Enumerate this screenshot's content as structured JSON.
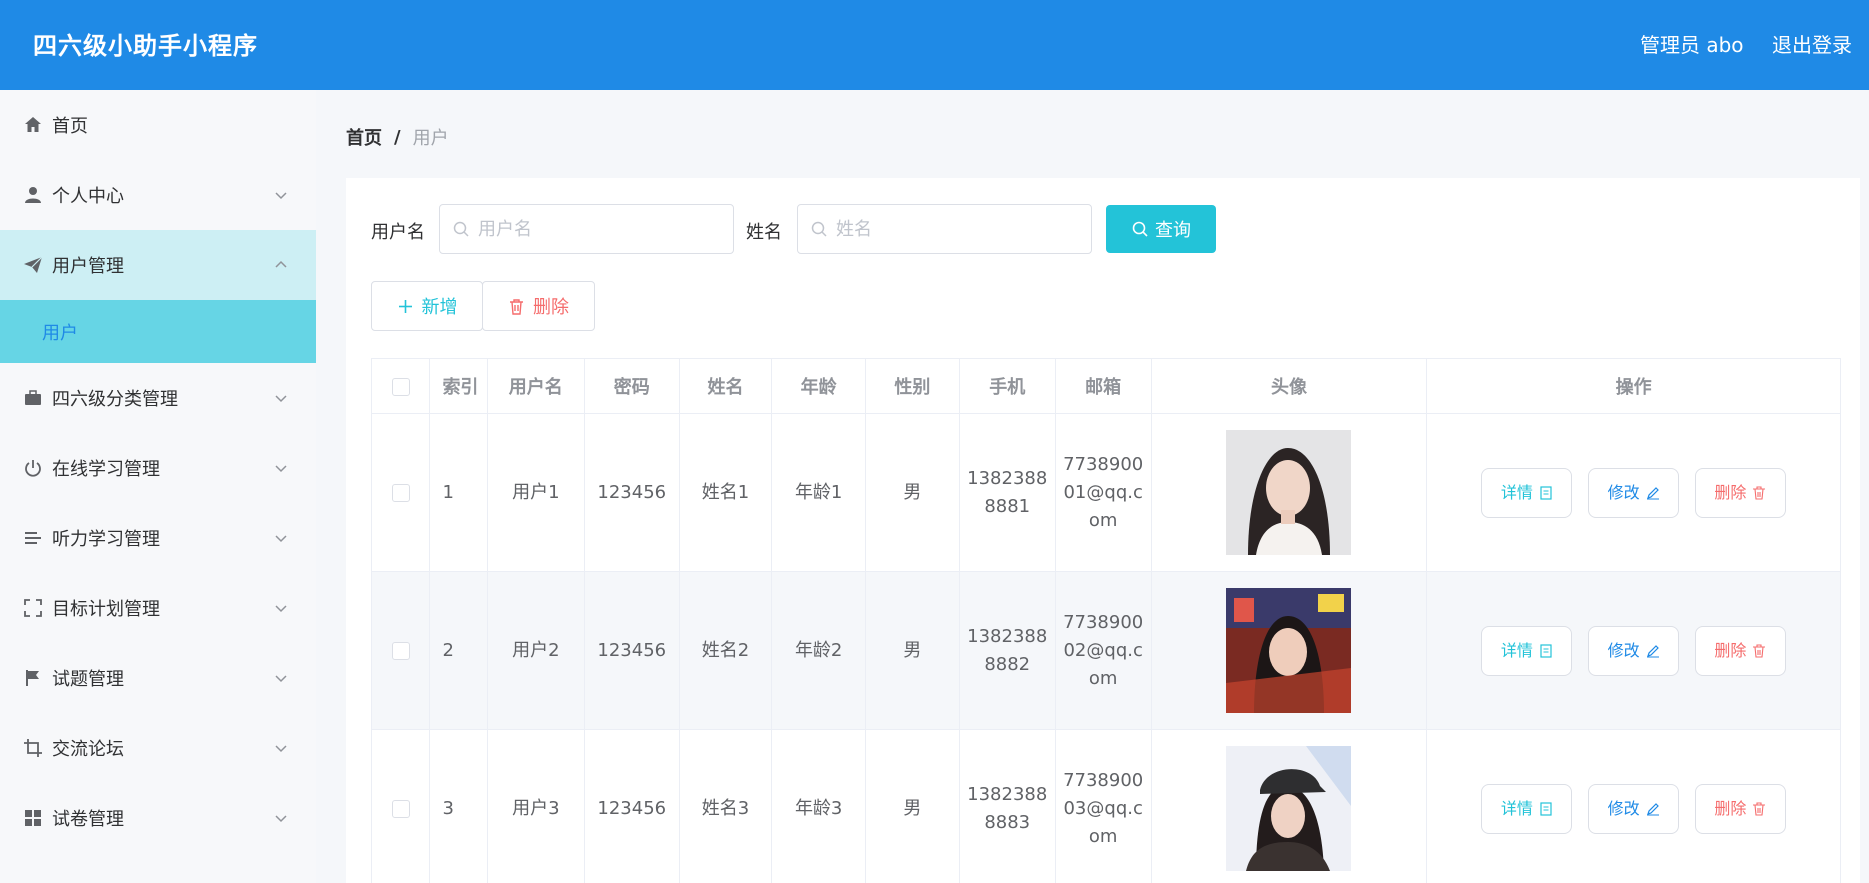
{
  "header": {
    "title": "四六级小助手小程序",
    "admin_label": "管理员 abo",
    "logout_label": "退出登录"
  },
  "sidebar": {
    "items": [
      {
        "label": "首页",
        "icon": "home-icon"
      },
      {
        "label": "个人中心",
        "icon": "user-icon"
      },
      {
        "label": "用户管理",
        "icon": "paper-plane-icon",
        "expanded": true,
        "children": [
          {
            "label": "用户",
            "active": true
          }
        ]
      },
      {
        "label": "四六级分类管理",
        "icon": "briefcase-icon"
      },
      {
        "label": "在线学习管理",
        "icon": "power-icon"
      },
      {
        "label": "听力学习管理",
        "icon": "list-icon"
      },
      {
        "label": "目标计划管理",
        "icon": "fullscreen-icon"
      },
      {
        "label": "试题管理",
        "icon": "flag-icon"
      },
      {
        "label": "交流论坛",
        "icon": "crop-icon"
      },
      {
        "label": "试卷管理",
        "icon": "grid-icon"
      }
    ]
  },
  "breadcrumb": {
    "home": "首页",
    "separator": "/",
    "current": "用户"
  },
  "search": {
    "username_label": "用户名",
    "username_placeholder": "用户名",
    "name_label": "姓名",
    "name_placeholder": "姓名",
    "query_button": "查询"
  },
  "actions": {
    "add_button": "新增",
    "delete_button": "删除"
  },
  "table": {
    "columns": [
      "索引",
      "用户名",
      "密码",
      "姓名",
      "年龄",
      "性别",
      "手机",
      "邮箱",
      "头像",
      "操作"
    ],
    "rows": [
      {
        "index": "1",
        "username": "用户1",
        "password": "123456",
        "name": "姓名1",
        "age": "年龄1",
        "gender": "男",
        "phone": "13823888881",
        "email": "773890001@qq.com"
      },
      {
        "index": "2",
        "username": "用户2",
        "password": "123456",
        "name": "姓名2",
        "age": "年龄2",
        "gender": "男",
        "phone": "13823888882",
        "email": "773890002@qq.com"
      },
      {
        "index": "3",
        "username": "用户3",
        "password": "123456",
        "name": "姓名3",
        "age": "年龄3",
        "gender": "男",
        "phone": "13823888883",
        "email": "773890003@qq.com"
      }
    ],
    "row_actions": {
      "detail": "详情",
      "edit": "修改",
      "delete": "删除"
    }
  },
  "colors": {
    "header": "#1f8ae6",
    "accent": "#23c3d8",
    "danger": "#f56c6c",
    "submenu_active": "#66d5e5",
    "submenu_open": "#cdeff4"
  }
}
